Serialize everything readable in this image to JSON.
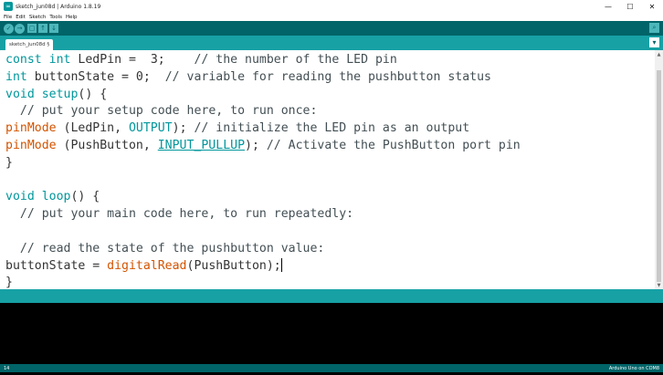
{
  "window": {
    "title": "sketch_jun08d | Arduino 1.8.19",
    "app_icon": "arduino-infinity-icon",
    "controls": {
      "minimize": "—",
      "maximize": "☐",
      "close": "✕"
    }
  },
  "menu": [
    "File",
    "Edit",
    "Sketch",
    "Tools",
    "Help"
  ],
  "toolbar": {
    "verify": "✓",
    "upload": "→",
    "new": "▢",
    "open": "↑",
    "save": "↓",
    "serial_monitor": "⌕"
  },
  "tab": {
    "label": "sketch_jun08d §",
    "menu_glyph": "▾"
  },
  "editor": {
    "lines": [
      [
        "const int LedPin =  3;",
        "    // the number of the LED pin"
      ],
      [
        "int buttonState = 0;",
        "  // variable for reading the pushbutton status"
      ],
      [
        "void setup() {"
      ],
      [
        "  // put your setup code here, to run once:"
      ],
      [
        "pinMode (LedPin, OUTPUT); // initialize the LED pin as an output"
      ],
      [
        "pinMode (PushButton, INPUT_PULLUP); // Activate the PushButton port pin"
      ],
      [
        "}"
      ],
      [
        ""
      ],
      [
        "void loop() {"
      ],
      [
        "  // put your main code here, to run repeatedly:"
      ],
      [
        ""
      ],
      [
        "  // read the state of the pushbutton value:"
      ],
      [
        "buttonState = digitalRead(PushButton);"
      ],
      [
        "}"
      ]
    ]
  },
  "status": {
    "line": "14",
    "board": "Arduino Uno on COM8"
  },
  "colors": {
    "toolbar": "#006468",
    "tab_strip": "#17a1a5",
    "keyword": "#00979c",
    "function": "#d35400"
  }
}
